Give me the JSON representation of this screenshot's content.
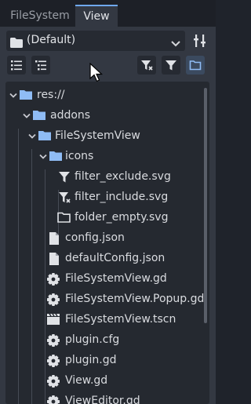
{
  "tabs": [
    {
      "label": "FileSystem"
    },
    {
      "label": "View"
    }
  ],
  "toolbar": {
    "profile_value": "(Default)"
  },
  "tree": {
    "root": "res://",
    "items": [
      {
        "label": "addons"
      },
      {
        "label": "FileSystemView"
      },
      {
        "label": "icons"
      },
      {
        "label": "filter_exclude.svg"
      },
      {
        "label": "filter_include.svg"
      },
      {
        "label": "folder_empty.svg"
      },
      {
        "label": "config.json"
      },
      {
        "label": "defaultConfig.json"
      },
      {
        "label": "FileSystemView.gd"
      },
      {
        "label": "FileSystemView.Popup.gd"
      },
      {
        "label": "FileSystemView.tscn"
      },
      {
        "label": "plugin.cfg"
      },
      {
        "label": "plugin.gd"
      },
      {
        "label": "View.gd"
      },
      {
        "label": "ViewEditor.gd"
      }
    ]
  },
  "colors": {
    "accent": "#6fa8ef",
    "folder": "#8fbcf5",
    "panel": "#333842",
    "tree_bg": "#252930"
  }
}
